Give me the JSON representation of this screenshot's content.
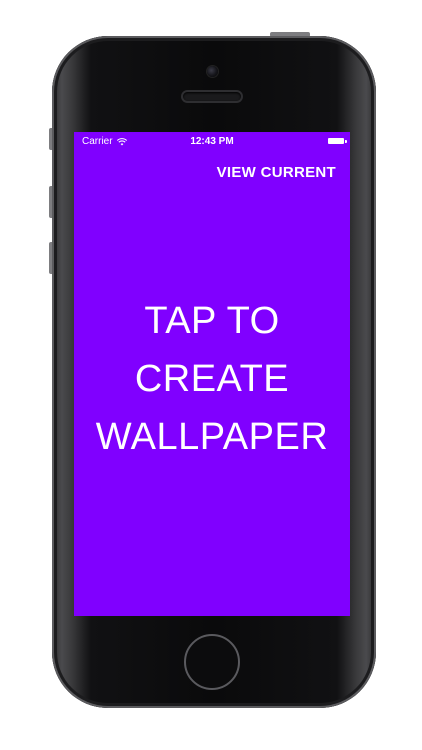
{
  "status_bar": {
    "carrier": "Carrier",
    "time": "12:43 PM"
  },
  "nav": {
    "view_current_label": "VIEW CURRENT"
  },
  "main": {
    "cta_lines": [
      "TAP TO",
      "CREATE",
      "WALLPAPER"
    ]
  },
  "colors": {
    "screen_background": "#8000ff",
    "text": "#ffffff",
    "device_body": "#0a0a0b"
  },
  "icons": {
    "wifi": "wifi-icon",
    "battery": "battery-icon"
  }
}
